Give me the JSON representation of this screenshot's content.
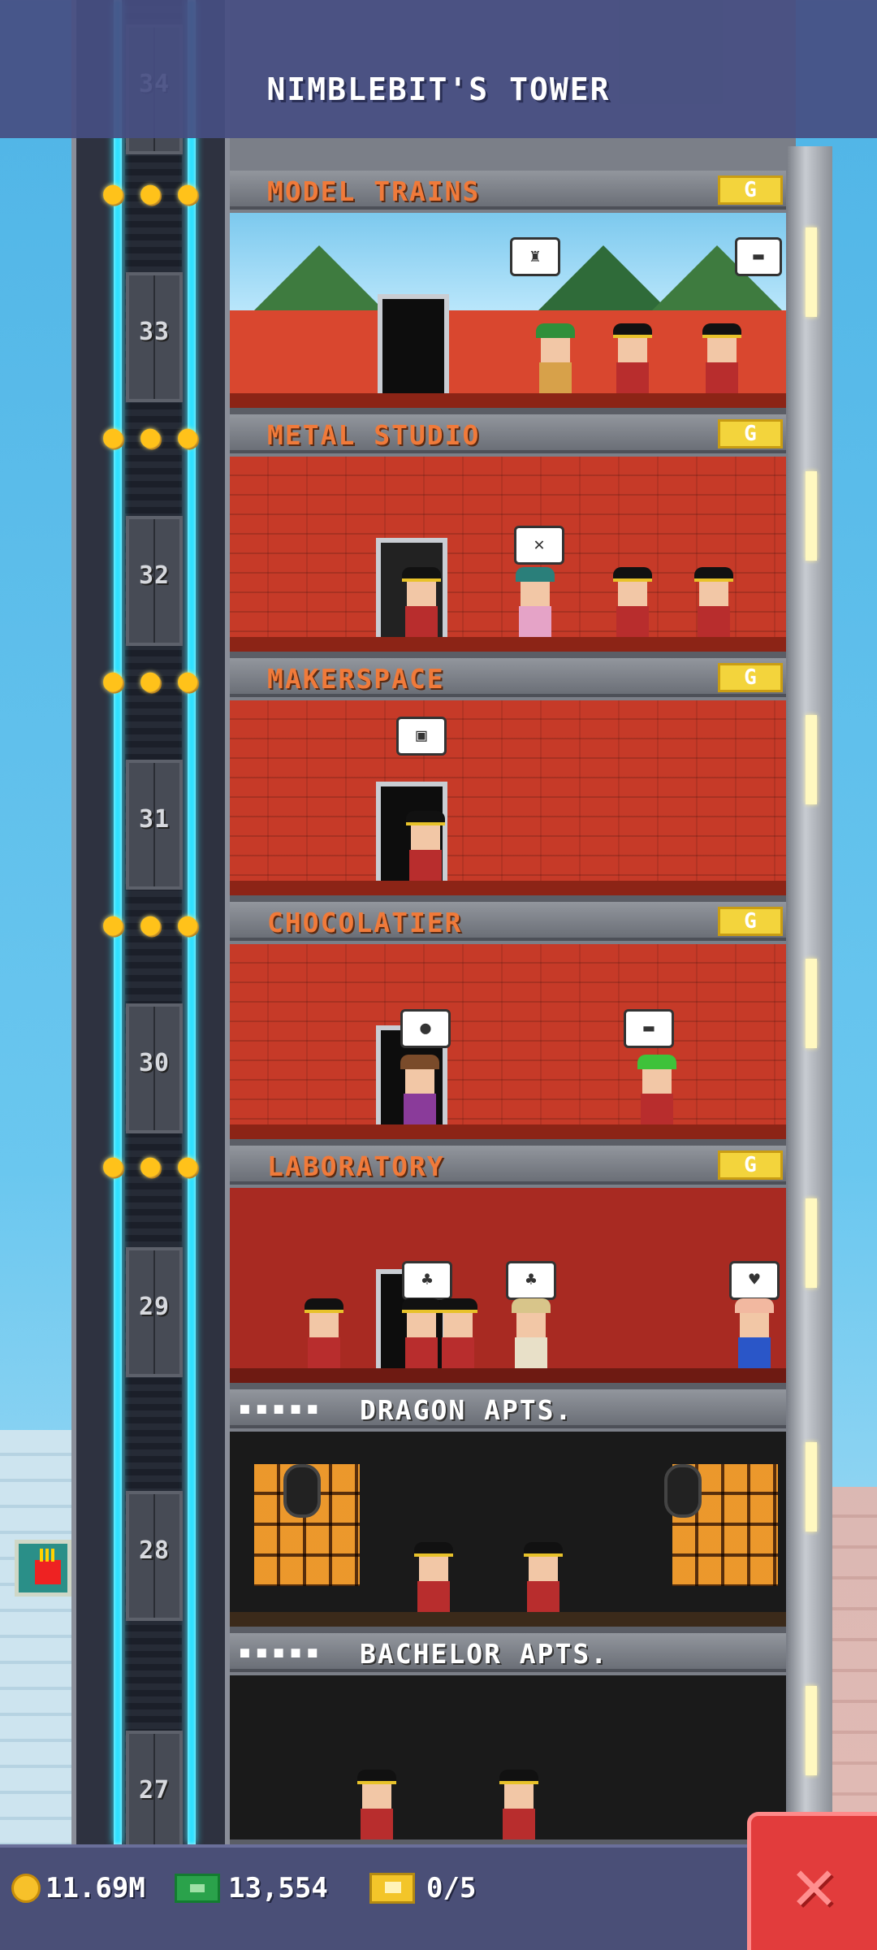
{
  "header": {
    "title": "NIMBLEBIT'S TOWER"
  },
  "floors": [
    {
      "number": "34"
    },
    {
      "number": "33",
      "name": "MODEL TRAINS",
      "type": "business",
      "stars": 3,
      "badge": "G"
    },
    {
      "number": "32",
      "name": "METAL STUDIO",
      "type": "business",
      "stars": 3,
      "badge": "G"
    },
    {
      "number": "31",
      "name": "MAKERSPACE",
      "type": "business",
      "stars": 3,
      "badge": "G"
    },
    {
      "number": "30",
      "name": "CHOCOLATIER",
      "type": "business",
      "stars": 3,
      "badge": "G"
    },
    {
      "number": "29",
      "name": "LABORATORY",
      "type": "business",
      "stars": 3,
      "badge": "G"
    },
    {
      "number": "28",
      "name": "DRAGON APTS.",
      "type": "residential",
      "residents": "▪▪▪▪▪"
    },
    {
      "number": "27",
      "name": "BACHELOR APTS.",
      "type": "residential",
      "residents": "▪▪▪▪▪"
    }
  ],
  "status": {
    "coins": "11.69M",
    "bux": "13,554",
    "tickets": "0/5"
  },
  "colors": {
    "header_bg": "#464e82",
    "business_label": "#f07a3a",
    "residential_label": "#ffffff",
    "elevator_cable": "#2ee0ff",
    "close_button": "#e23c3c"
  },
  "icons": {
    "star": "star-icon",
    "coin": "coin-icon",
    "bux": "bux-icon",
    "ticket": "ticket-icon",
    "close": "close-icon"
  }
}
